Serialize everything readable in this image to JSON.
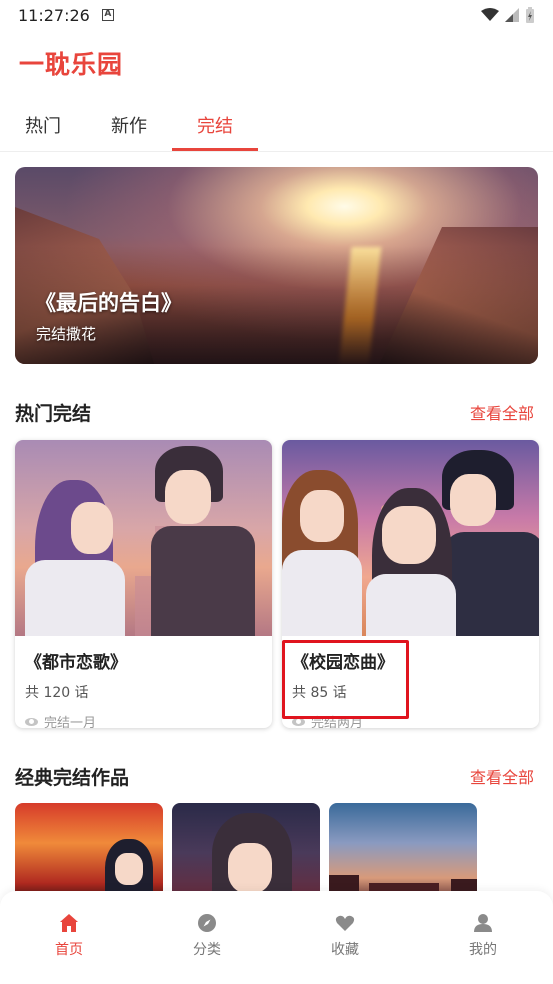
{
  "status_bar": {
    "time": "11:27:26",
    "notification_icon": "A"
  },
  "app": {
    "title": "一耽乐园"
  },
  "tabs": [
    {
      "label": "热门",
      "active": false
    },
    {
      "label": "新作",
      "active": false
    },
    {
      "label": "完结",
      "active": true
    }
  ],
  "hero": {
    "title": "《最后的告白》",
    "subtitle": "完结撒花"
  },
  "hot_section": {
    "title": "热门完结",
    "link": "查看全部",
    "cards": [
      {
        "title": "《都市恋歌》",
        "count": "共 120 话",
        "status": "完结一月"
      },
      {
        "title": "《校园恋曲》",
        "count": "共 85 话",
        "status": "完结两月"
      }
    ]
  },
  "classic_section": {
    "title": "经典完结作品",
    "link": "查看全部"
  },
  "bottom_nav": [
    {
      "label": "首页",
      "icon": "home-icon",
      "active": true
    },
    {
      "label": "分类",
      "icon": "compass-icon",
      "active": false
    },
    {
      "label": "收藏",
      "icon": "heart-icon",
      "active": false
    },
    {
      "label": "我的",
      "icon": "user-icon",
      "active": false
    }
  ],
  "colors": {
    "accent": "#e8453c",
    "highlight_box": "#e0141e"
  }
}
